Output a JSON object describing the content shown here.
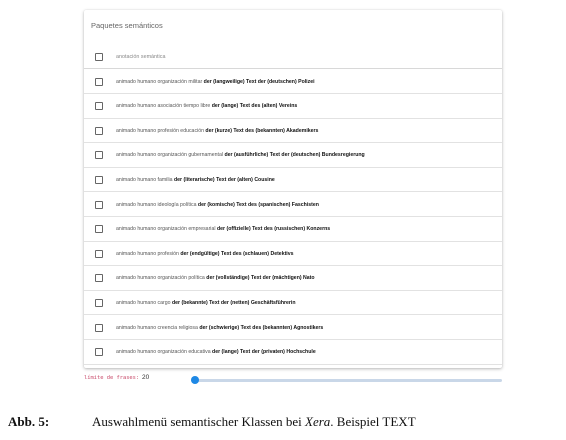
{
  "panel": {
    "title": "Paquetes semánticos",
    "header_label": "anotación semántica",
    "rows": [
      {
        "desc": "animado humano organización militar",
        "tpl": "der (langweilige) Text der (deutschen) Polizei"
      },
      {
        "desc": "animado humano asociación tiempo libre",
        "tpl": "der (lange) Text des (alten) Vereins"
      },
      {
        "desc": "animado humano profesión educación",
        "tpl": "der (kurze) Text des (bekannten) Akademikers"
      },
      {
        "desc": "animado humano organización gubernamental",
        "tpl": "der (ausführliche) Text der (deutschen) Bundesregierung"
      },
      {
        "desc": "animado humano familia",
        "tpl": "der (literarische) Text der (alten) Cousine"
      },
      {
        "desc": "animado humano ideología política",
        "tpl": "der (komische) Text des (spanischen) Faschisten"
      },
      {
        "desc": "animado humano organización empresarial",
        "tpl": "der (offizielle) Text des (russischen) Konzerns"
      },
      {
        "desc": "animado humano profesión",
        "tpl": "der (endgültige) Text des (schlauen) Detektivs"
      },
      {
        "desc": "animado humano organización política",
        "tpl": "der (vollständige) Text der (mächtigen) Nato"
      },
      {
        "desc": "animado humano cargo",
        "tpl": "der (bekannte) Text der (netten) Geschäftsführerin"
      },
      {
        "desc": "animado humano creencia religiosa",
        "tpl": "der (schwierige) Text des (bekannten) Agnostikers"
      },
      {
        "desc": "animado humano organización educativa",
        "tpl": "der (lange) Text der (privaten) Hochschule"
      }
    ]
  },
  "slider": {
    "label": "límite de frases:",
    "value": "20",
    "fraction": 0.0,
    "accent": "#1e88e5"
  },
  "caption": {
    "number": "Abb. 5:",
    "text_before": "Auswahlmenü semantischer Klassen bei ",
    "italic": "Xera",
    "text_after": ". Beispiel TEXT"
  }
}
